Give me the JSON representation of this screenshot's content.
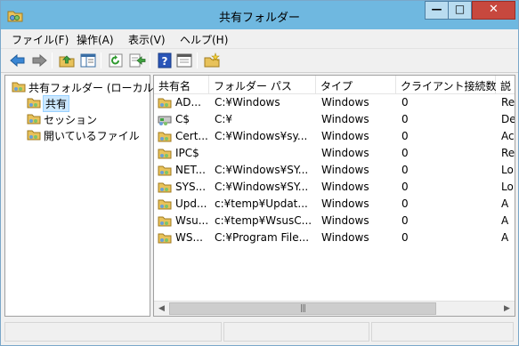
{
  "window": {
    "title": "共有フォルダー",
    "minimize_glyph": "—",
    "maximize_glyph": "□",
    "close_glyph": "✕"
  },
  "menu": [
    {
      "label": "ファイル(F)"
    },
    {
      "label": "操作(A)"
    },
    {
      "label": "表示(V)"
    },
    {
      "label": "ヘルプ(H)"
    }
  ],
  "toolbar": {
    "icons": [
      "back-icon",
      "forward-icon",
      "up-folder-icon",
      "show-hide-tree-icon",
      "refresh-icon",
      "export-list-icon",
      "help-icon",
      "properties-icon",
      "new-share-icon"
    ]
  },
  "tree": {
    "root": "共有フォルダー (ローカル)",
    "items": [
      {
        "label": "共有",
        "selected": true
      },
      {
        "label": "セッション",
        "selected": false
      },
      {
        "label": "開いているファイル",
        "selected": false
      }
    ]
  },
  "list": {
    "columns": [
      "共有名",
      "フォルダー パス",
      "タイプ",
      "クライアント接続数",
      "説"
    ],
    "rows": [
      {
        "name": "AD...",
        "path": "C:¥Windows",
        "type": "Windows",
        "clients": "0",
        "desc": "Re"
      },
      {
        "name": "C$",
        "path": "C:¥",
        "type": "Windows",
        "clients": "0",
        "desc": "De"
      },
      {
        "name": "Cert...",
        "path": "C:¥Windows¥sy...",
        "type": "Windows",
        "clients": "0",
        "desc": "Ac"
      },
      {
        "name": "IPC$",
        "path": "",
        "type": "Windows",
        "clients": "0",
        "desc": "Re"
      },
      {
        "name": "NET...",
        "path": "C:¥Windows¥SY...",
        "type": "Windows",
        "clients": "0",
        "desc": "Lo"
      },
      {
        "name": "SYS...",
        "path": "C:¥Windows¥SY...",
        "type": "Windows",
        "clients": "0",
        "desc": "Lo"
      },
      {
        "name": "Upd...",
        "path": "c:¥temp¥Updat...",
        "type": "Windows",
        "clients": "0",
        "desc": "A"
      },
      {
        "name": "Wsu...",
        "path": "c:¥temp¥WsusC...",
        "type": "Windows",
        "clients": "0",
        "desc": "A"
      },
      {
        "name": "WS...",
        "path": "C:¥Program File...",
        "type": "Windows",
        "clients": "0",
        "desc": "A"
      }
    ]
  },
  "scrollbar": {
    "left_arrow": "◀",
    "right_arrow": "▶",
    "grip": "|||"
  },
  "colors": {
    "titlebar": "#6fb8e0",
    "close_button": "#c7483e",
    "selection": "#cce8ff"
  }
}
